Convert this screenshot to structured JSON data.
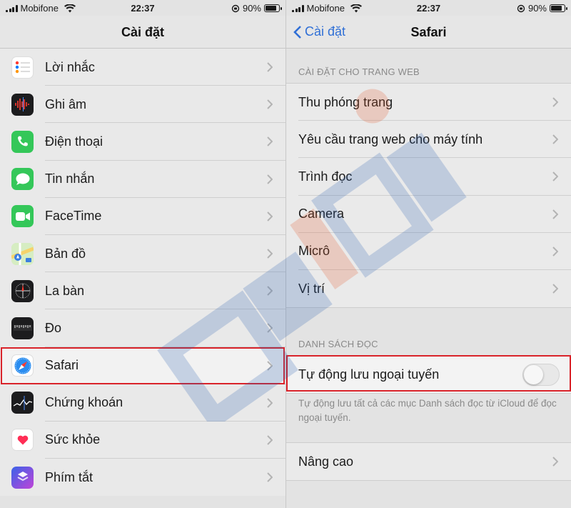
{
  "status": {
    "carrier": "Mobifone",
    "time": "22:37",
    "battery": "90%"
  },
  "left": {
    "title": "Cài đặt",
    "items": [
      {
        "label": "Lời nhắc",
        "icon": "reminders-icon",
        "color": "#ffffff"
      },
      {
        "label": "Ghi âm",
        "icon": "voice-memos-icon",
        "color": "#1c1c1e"
      },
      {
        "label": "Điện thoại",
        "icon": "phone-icon",
        "color": "#34c759"
      },
      {
        "label": "Tin nhắn",
        "icon": "messages-icon",
        "color": "#34c759"
      },
      {
        "label": "FaceTime",
        "icon": "facetime-icon",
        "color": "#34c759"
      },
      {
        "label": "Bản đồ",
        "icon": "maps-icon",
        "color": "#9cd67a"
      },
      {
        "label": "La bàn",
        "icon": "compass-icon",
        "color": "#1c1c1e"
      },
      {
        "label": "Đo",
        "icon": "measure-icon",
        "color": "#1c1c1e"
      },
      {
        "label": "Safari",
        "icon": "safari-icon",
        "color": "#ffffff"
      },
      {
        "label": "Chứng khoán",
        "icon": "stocks-icon",
        "color": "#1c1c1e"
      },
      {
        "label": "Sức khỏe",
        "icon": "health-icon",
        "color": "#ffffff"
      },
      {
        "label": "Phím tắt",
        "icon": "shortcuts-icon",
        "color": "#5b4fd6"
      }
    ]
  },
  "right": {
    "back_label": "Cài đặt",
    "title": "Safari",
    "section1_header": "CÀI ĐẶT CHO TRANG WEB",
    "section1_items": [
      "Thu phóng trang",
      "Yêu cầu trang web cho máy tính",
      "Trình đọc",
      "Camera",
      "Micrô",
      "Vị trí"
    ],
    "section2_header": "DANH SÁCH ĐỌC",
    "toggle_label": "Tự động lưu ngoại tuyến",
    "toggle_on": false,
    "footer_note": "Tự động lưu tất cả các mục Danh sách đọc từ iCloud để đọc ngoại tuyến.",
    "advanced_label": "Nâng cao"
  },
  "accent": "#d9232a"
}
